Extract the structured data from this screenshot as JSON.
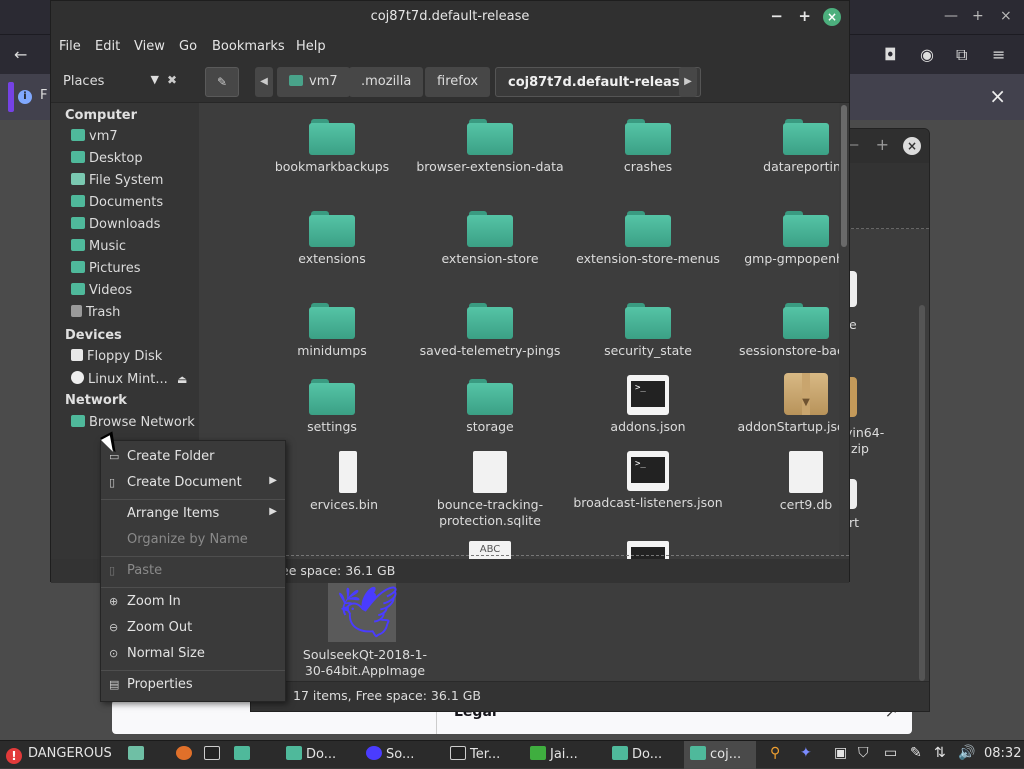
{
  "window": {
    "title": "coj87t7d.default-release",
    "min_label": "−",
    "max_label": "+",
    "close_label": "×"
  },
  "menubar": [
    "File",
    "Edit",
    "View",
    "Go",
    "Bookmarks",
    "Help"
  ],
  "toolbar": {
    "places_label": "Places",
    "breadcrumbs": [
      "vm7",
      ".mozilla",
      "firefox",
      "coj87t7d.default-release"
    ]
  },
  "sidebar": {
    "computer_header": "Computer",
    "computer_items": [
      "vm7",
      "Desktop",
      "File System",
      "Documents",
      "Downloads",
      "Music",
      "Pictures",
      "Videos",
      "Trash"
    ],
    "devices_header": "Devices",
    "device_items": [
      "Floppy Disk",
      "Linux Mint..."
    ],
    "network_header": "Network",
    "network_items": [
      "Browse Network"
    ]
  },
  "files": {
    "row1": [
      "bookmarkbackups",
      "browser-extension-data",
      "crashes",
      "datareporting"
    ],
    "row2": [
      "extensions",
      "extension-store",
      "extension-store-menus",
      "gmp-gmpopenh264"
    ],
    "row3": [
      "minidumps",
      "saved-telemetry-pings",
      "security_state",
      "sessionstore-backups"
    ],
    "row4": [
      "settings",
      "storage",
      "addons.json",
      "addonStartup.json.lz4"
    ],
    "row5": [
      "ervices.bin",
      "bounce-tracking-protection.sqlite",
      "broadcast-listeners.json",
      "cert9.db"
    ],
    "abc_label": "ABC",
    "term_glyph": ">_"
  },
  "status": {
    "main": "ee space: 36.1 GB",
    "back": "17 items, Free space: 36.1 GB"
  },
  "context_menu": {
    "create_folder": "Create Folder",
    "create_document": "Create Document",
    "arrange_items": "Arrange Items",
    "organize_by_name": "Organize by Name",
    "paste": "Paste",
    "zoom_in": "Zoom In",
    "zoom_out": "Zoom Out",
    "normal_size": "Normal Size",
    "properties": "Properties"
  },
  "background_window": {
    "items": [
      "e",
      "vin64-",
      ".zip",
      "rt"
    ],
    "soulseek_label_1": "SoulseekQt-2018-1-",
    "soulseek_label_2": "30-64bit.AppImage"
  },
  "browser": {
    "info_letter": "F",
    "legal": "Legal"
  },
  "taskbar": {
    "dangerous": "DANGEROUS",
    "tasks": [
      "Do...",
      "So...",
      "Ter...",
      "Jai...",
      "Do...",
      "coj..."
    ],
    "clock": "08:32"
  },
  "colors": {
    "folder": "#4fb99b",
    "close_green": "#4caf7d",
    "danger_red": "#e23a3a"
  }
}
